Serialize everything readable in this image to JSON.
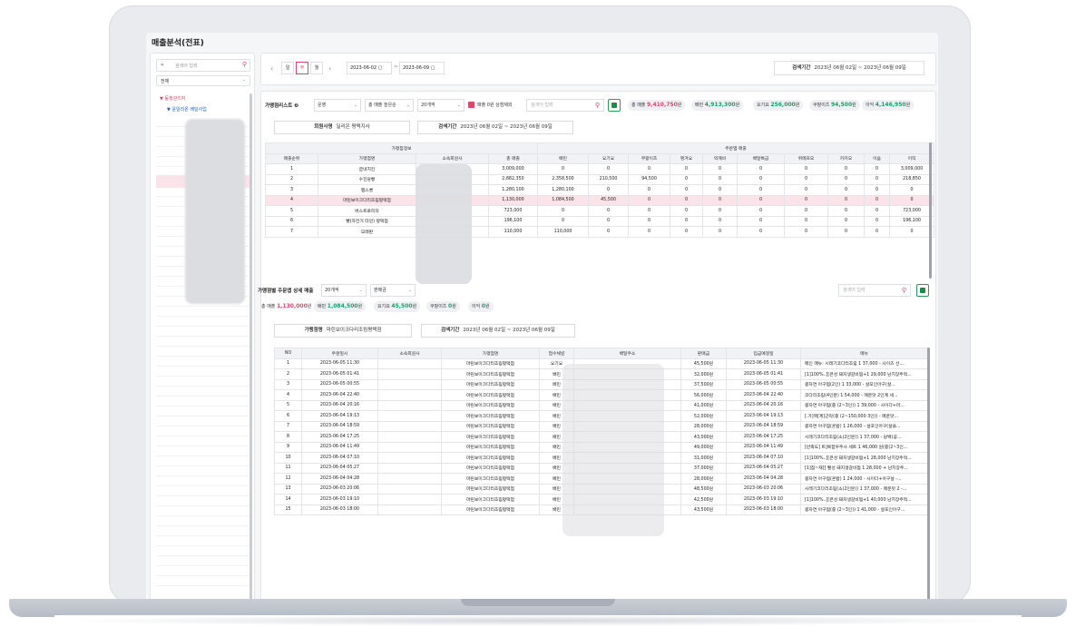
{
  "page_title": "매출분석(전표)",
  "sidebar": {
    "search_placeholder": "검색어 입력",
    "collapse_icon": "«",
    "filter_value": "전체",
    "tree_root": "▼ 동행관리자",
    "tree_child": "▼ 윤일리온 배달사업"
  },
  "topbar": {
    "tabs": [
      "일",
      "주",
      "월"
    ],
    "active_tab": "주",
    "date_from": "2023-06-02",
    "date_to": "2023-06-09",
    "date_sep": "~",
    "period_label": "검색기간",
    "period_value": "2023년 06월 02일 ~ 2023년 06월 09일"
  },
  "store_list": {
    "title": "가맹점리스트",
    "filter1": "운영",
    "filter2": "총 매출 높은순",
    "filter3": "20개씩",
    "checkbox_label": "매출 0원 상점제외",
    "search_placeholder": "검색어 입력",
    "stats": [
      {
        "label": "총 매출",
        "value": "9,410,750",
        "unit": "원",
        "color": "#e0446a"
      },
      {
        "label": "배민",
        "value": "4,913,300",
        "unit": "원",
        "color": "#1f9d6a"
      },
      {
        "label": "요기요",
        "value": "256,000",
        "unit": "원",
        "color": "#1f9d6a"
      },
      {
        "label": "쿠팡이츠",
        "value": "94,500",
        "unit": "원",
        "color": "#1f9d6a"
      },
      {
        "label": "이익",
        "value": "4,146,950",
        "unit": "원",
        "color": "#1f9d6a"
      }
    ],
    "member_label": "회원사명",
    "member_value": "딜리온 평택지사",
    "period_label": "검색기간",
    "period_value": "2023년 06월 02일 ~ 2023년 06월 09일",
    "group_headers": [
      "가맹점정보",
      "주문앱 매출"
    ],
    "columns": [
      "매출순위",
      "가맹점명",
      "소속회원사",
      "총 매출",
      "배민",
      "요기요",
      "쿠팡이츠",
      "땡겨요",
      "먹깨비",
      "배달특급",
      "위메프오",
      "카카오",
      "이음",
      "이익"
    ],
    "rows": [
      {
        "rank": "1",
        "name": "굽네치킨",
        "total": "3,009,000",
        "baemin": "0",
        "yogiyo": "0",
        "coupang": "0",
        "ddang": "0",
        "meok": "0",
        "teukgeup": "0",
        "wemef": "0",
        "kakao": "0",
        "ieum": "0",
        "profit": "3,009,000"
      },
      {
        "rank": "2",
        "name": "수진당빵",
        "total": "2,882,350",
        "baemin": "2,358,500",
        "yogiyo": "210,500",
        "coupang": "94,500",
        "ddang": "0",
        "meok": "0",
        "teukgeup": "0",
        "wemef": "0",
        "kakao": "0",
        "ieum": "0",
        "profit": "218,850"
      },
      {
        "rank": "3",
        "name": "팹스쿨",
        "total": "1,280,100",
        "baemin": "1,280,100",
        "yogiyo": "0",
        "coupang": "0",
        "ddang": "0",
        "meok": "0",
        "teukgeup": "0",
        "wemef": "0",
        "kakao": "0",
        "ieum": "0",
        "profit": "0"
      },
      {
        "rank": "4",
        "name": "마린보이크다리조림평택점",
        "total": "1,130,000",
        "baemin": "1,084,500",
        "yogiyo": "45,500",
        "coupang": "0",
        "ddang": "0",
        "meok": "0",
        "teukgeup": "0",
        "wemef": "0",
        "kakao": "0",
        "ieum": "0",
        "profit": "0"
      },
      {
        "rank": "5",
        "name": "버스트로피자",
        "total": "723,000",
        "baemin": "0",
        "yogiyo": "0",
        "coupang": "0",
        "ddang": "0",
        "meok": "0",
        "teukgeup": "0",
        "wemef": "0",
        "kakao": "0",
        "ieum": "0",
        "profit": "723,000"
      },
      {
        "rank": "6",
        "name": "뻘(자전거 타던) 평택점",
        "total": "196,100",
        "baemin": "0",
        "yogiyo": "0",
        "coupang": "0",
        "ddang": "0",
        "meok": "0",
        "teukgeup": "0",
        "wemef": "0",
        "kakao": "0",
        "ieum": "0",
        "profit": "196,100"
      },
      {
        "rank": "7",
        "name": "모래판",
        "total": "110,000",
        "baemin": "110,000",
        "yogiyo": "0",
        "coupang": "0",
        "ddang": "0",
        "meok": "0",
        "teukgeup": "0",
        "wemef": "0",
        "kakao": "0",
        "ieum": "0",
        "profit": "0"
      }
    ]
  },
  "detail": {
    "title": "가맹점별 주문앱 상세 매출",
    "filter1": "20개씩",
    "filter2": "판매금",
    "search_placeholder": "검색어 입력",
    "stats": [
      {
        "label": "총 매출",
        "value": "1,130,000",
        "unit": "원",
        "color": "#e0446a"
      },
      {
        "label": "배민",
        "value": "1,084,500",
        "unit": "원",
        "color": "#1f9d6a"
      },
      {
        "label": "요기요",
        "value": "45,500",
        "unit": "원",
        "color": "#1f9d6a"
      },
      {
        "label": "쿠팡이츠",
        "value": "0",
        "unit": "원",
        "color": "#1f9d6a"
      },
      {
        "label": "이익",
        "value": "0",
        "unit": "원",
        "color": "#1f9d6a"
      }
    ],
    "store_label": "가맹점명",
    "store_value": "마린보이크다리조림평택점",
    "period_label": "검색기간",
    "period_value": "2023년 06월 02일 ~ 2023년 06월 09일",
    "columns": [
      "NO",
      "주문일시",
      "소속회원사",
      "가맹점명",
      "접수채널",
      "배달주소",
      "판매금",
      "입금예정일",
      "메뉴"
    ],
    "store_name": "마린보이크다리조림평택점",
    "rows": [
      {
        "no": "1",
        "dt": "2023-06-05 11:30",
        "ch": "요기요",
        "amt": "45,500원",
        "pay": "2023-06-05 11:30",
        "menu": "메인 메뉴: 시래기코다리조림 1 37,000 - 사이즈 선..."
      },
      {
        "no": "2",
        "dt": "2023-06-05 01:41",
        "ch": "배민",
        "amt": "32,000원",
        "pay": "2023-06-05 01:41",
        "menu": "[1]100%..][큰성 돼지생갈비찜+1 29,000 남치장주먹..."
      },
      {
        "no": "3",
        "dt": "2023-06-05 00:55",
        "ch": "배민",
        "amt": "37,500원",
        "pay": "2023-06-05 00:55",
        "menu": "콩자연 아구찜(2인) 1 33,000 - 살포인아구(살..."
      },
      {
        "no": "4",
        "dt": "2023-06-04 22:40",
        "ch": "배민",
        "amt": "56,000원",
        "pay": "2023-06-04 22:40",
        "menu": "코다리조림(4인분) 1 54,000 - 메운맛 2인계 세..."
      },
      {
        "no": "5",
        "dt": "2023-06-04 20:16",
        "ch": "배민",
        "amt": "41,000원",
        "pay": "2023-06-04 20:16",
        "menu": "콩자연 아구찜(중 (2~3인)) 1 39,000 - 사이다+마..."
      },
      {
        "no": "6",
        "dt": "2023-06-04 19:13",
        "ch": "배민",
        "amt": "52,000원",
        "pay": "2023-06-04 19:13",
        "menu": "[.가]맥[제]근막(중 (2~150,000 3인)) - 메운맛..."
      },
      {
        "no": "7",
        "dt": "2023-06-04 18:59",
        "ch": "배민",
        "amt": "28,000원",
        "pay": "2023-06-04 18:59",
        "menu": "콩자연 아구찜(혼밥) 1 26,000 - 살포인아구(살을..."
      },
      {
        "no": "8",
        "dt": "2023-06-04 17:25",
        "ch": "배민",
        "amt": "43,000원",
        "pay": "2023-06-04 17:25",
        "menu": "시래기코다리조림(소(2인분)) 1 37,000 - 당백(공..."
      },
      {
        "no": "9",
        "dt": "2023-06-04 11:49",
        "ch": "배민",
        "amt": "49,000원",
        "pay": "2023-06-04 11:49",
        "menu": "[반죽도] 트]복합우주사 세트 1 46,000 원(중(2~3인..."
      },
      {
        "no": "10",
        "dt": "2023-06-04 07:10",
        "ch": "배민",
        "amt": "31,000원",
        "pay": "2023-06-04 07:10",
        "menu": "[1]100%..][큰성 돼지생갈비찜+1 28,000 남치장주먹..."
      },
      {
        "no": "11",
        "dt": "2023-06-04 05:27",
        "ch": "배민",
        "amt": "37,000원",
        "pay": "2023-06-04 05:27",
        "menu": "[1]점~재]] 빨성 돼지생갈비찜 1 28,000 + 남치장주..."
      },
      {
        "no": "12",
        "dt": "2023-06-04 04:28",
        "ch": "배민",
        "amt": "28,000원",
        "pay": "2023-06-04 04:28",
        "menu": "콩자연 아구찜(혼밥) 1 24,000 - 사이다+아구살 -..."
      },
      {
        "no": "13",
        "dt": "2023-06-03 20:06",
        "ch": "배민",
        "amt": "48,500원",
        "pay": "2023-06-03 20:06",
        "menu": "시래기코다리조림(소(2인분)) 1 37,000 - 메운맛 2 -..."
      },
      {
        "no": "14",
        "dt": "2023-06-03 19:10",
        "ch": "배민",
        "amt": "42,500원",
        "pay": "2023-06-03 19:10",
        "menu": "[1]100%..][큰성 돼지생갈비찜+1 40,000 남치장주먹..."
      },
      {
        "no": "15",
        "dt": "2023-06-03 18:00",
        "ch": "배민",
        "amt": "43,500원",
        "pay": "2023-06-03 18:00",
        "menu": "콩자연 아구찜(중 (2~3인)) 1 41,000 - 살포인아구..."
      }
    ]
  }
}
